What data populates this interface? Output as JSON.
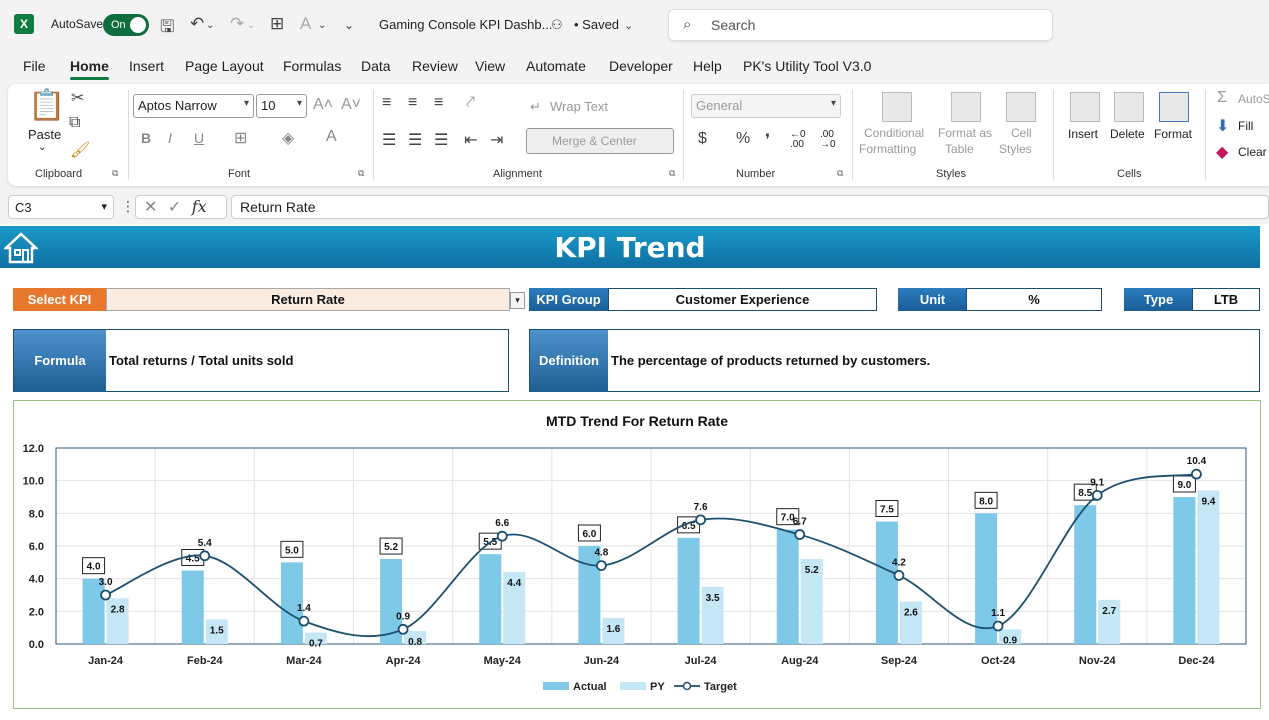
{
  "titlebar": {
    "autosave_label": "AutoSave",
    "autosave_state": "On",
    "doc_title": "Gaming Console KPI Dashb...",
    "saved_status": "• Saved",
    "search_placeholder": "Search"
  },
  "menu_tabs": [
    "File",
    "Home",
    "Insert",
    "Page Layout",
    "Formulas",
    "Data",
    "Review",
    "View",
    "Automate",
    "Developer",
    "Help",
    "PK's Utility Tool V3.0"
  ],
  "active_tab": "Home",
  "ribbon": {
    "clipboard": {
      "paste": "Paste",
      "label": "Clipboard"
    },
    "font": {
      "family": "Aptos Narrow",
      "size": "10",
      "label": "Font"
    },
    "alignment": {
      "wrap_text": "Wrap Text",
      "merge_center": "Merge & Center",
      "label": "Alignment"
    },
    "number": {
      "format": "General",
      "label": "Number"
    },
    "styles": {
      "conditional": "Conditional",
      "formatting": "Formatting",
      "format_as": "Format as",
      "table": "Table",
      "cell": "Cell",
      "styles_btn": "Styles",
      "label": "Styles"
    },
    "cells": {
      "insert": "Insert",
      "delete": "Delete",
      "format": "Format",
      "label": "Cells"
    },
    "editing": {
      "autosum": "AutoS",
      "fill": "Fill",
      "clear": "Clear"
    }
  },
  "formula_bar": {
    "cell_ref": "C3",
    "formula": "Return Rate"
  },
  "dashboard": {
    "title": "KPI Trend",
    "select_kpi_label": "Select KPI",
    "select_kpi_value": "Return Rate",
    "kpi_group_label": "KPI Group",
    "kpi_group_value": "Customer Experience",
    "unit_label": "Unit",
    "unit_value": "%",
    "type_label": "Type",
    "type_value": "LTB",
    "formula_label": "Formula",
    "formula_value": "Total returns / Total units sold",
    "definition_label": "Definition",
    "definition_value": "The percentage of products returned by customers."
  },
  "chart_data": {
    "type": "bar",
    "title": "MTD Trend For Return Rate",
    "categories": [
      "Jan-24",
      "Feb-24",
      "Mar-24",
      "Apr-24",
      "May-24",
      "Jun-24",
      "Jul-24",
      "Aug-24",
      "Sep-24",
      "Oct-24",
      "Nov-24",
      "Dec-24"
    ],
    "series": [
      {
        "name": "Actual",
        "type": "bar",
        "color": "#7ec8e8",
        "values": [
          4.0,
          4.5,
          5.0,
          5.2,
          5.5,
          6.0,
          6.5,
          7.0,
          7.5,
          8.0,
          8.5,
          9.0
        ]
      },
      {
        "name": "PY",
        "type": "bar",
        "color": "#c4e6f5",
        "values": [
          2.8,
          1.5,
          0.7,
          0.8,
          4.4,
          1.6,
          3.5,
          5.2,
          2.6,
          0.9,
          2.7,
          9.4
        ]
      },
      {
        "name": "Target",
        "type": "line",
        "color": "#1d4f6e",
        "values": [
          3.0,
          5.4,
          1.4,
          0.9,
          6.6,
          4.8,
          7.6,
          6.7,
          4.2,
          1.1,
          9.1,
          10.4
        ]
      }
    ],
    "y_ticks": [
      "0.0",
      "2.0",
      "4.0",
      "6.0",
      "8.0",
      "10.0",
      "12.0"
    ],
    "ylim": [
      0,
      12
    ],
    "legend_position": "bottom",
    "grid": true
  }
}
